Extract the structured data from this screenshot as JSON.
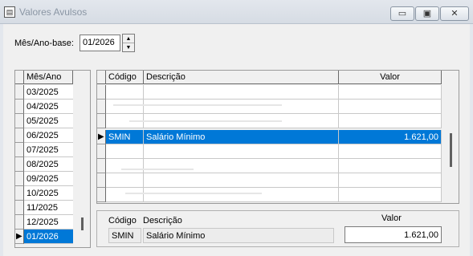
{
  "window": {
    "title": "Valores Avulsos",
    "icon": "app-icon",
    "min_glyph": "▭",
    "max_glyph": "▣",
    "close_glyph": "✕"
  },
  "mesano": {
    "label": "Mês/Ano-base:",
    "value": "01/2026",
    "up_glyph": "▲",
    "down_glyph": "▼"
  },
  "months": {
    "header": "Mês/Ano",
    "rows": [
      "03/2025",
      "04/2025",
      "05/2025",
      "06/2025",
      "07/2025",
      "08/2025",
      "09/2025",
      "10/2025",
      "11/2025",
      "12/2025",
      "01/2026"
    ],
    "selected_index": 10,
    "arrow": "▶"
  },
  "values_grid": {
    "headers": {
      "codigo": "Código",
      "descricao": "Descrição",
      "valor": "Valor"
    },
    "selected_row": {
      "codigo": "SMIN",
      "descricao": "Salário Mínimo",
      "valor": "1.621,00"
    },
    "arrow": "▶"
  },
  "detail": {
    "codigo_label": "Código",
    "descricao_label": "Descrição",
    "valor_label": "Valor",
    "codigo": "SMIN",
    "descricao": "Salário Mínimo",
    "valor": "1.621,00"
  },
  "colors": {
    "selection": "#0078d7",
    "title_text": "#8a96a4"
  }
}
